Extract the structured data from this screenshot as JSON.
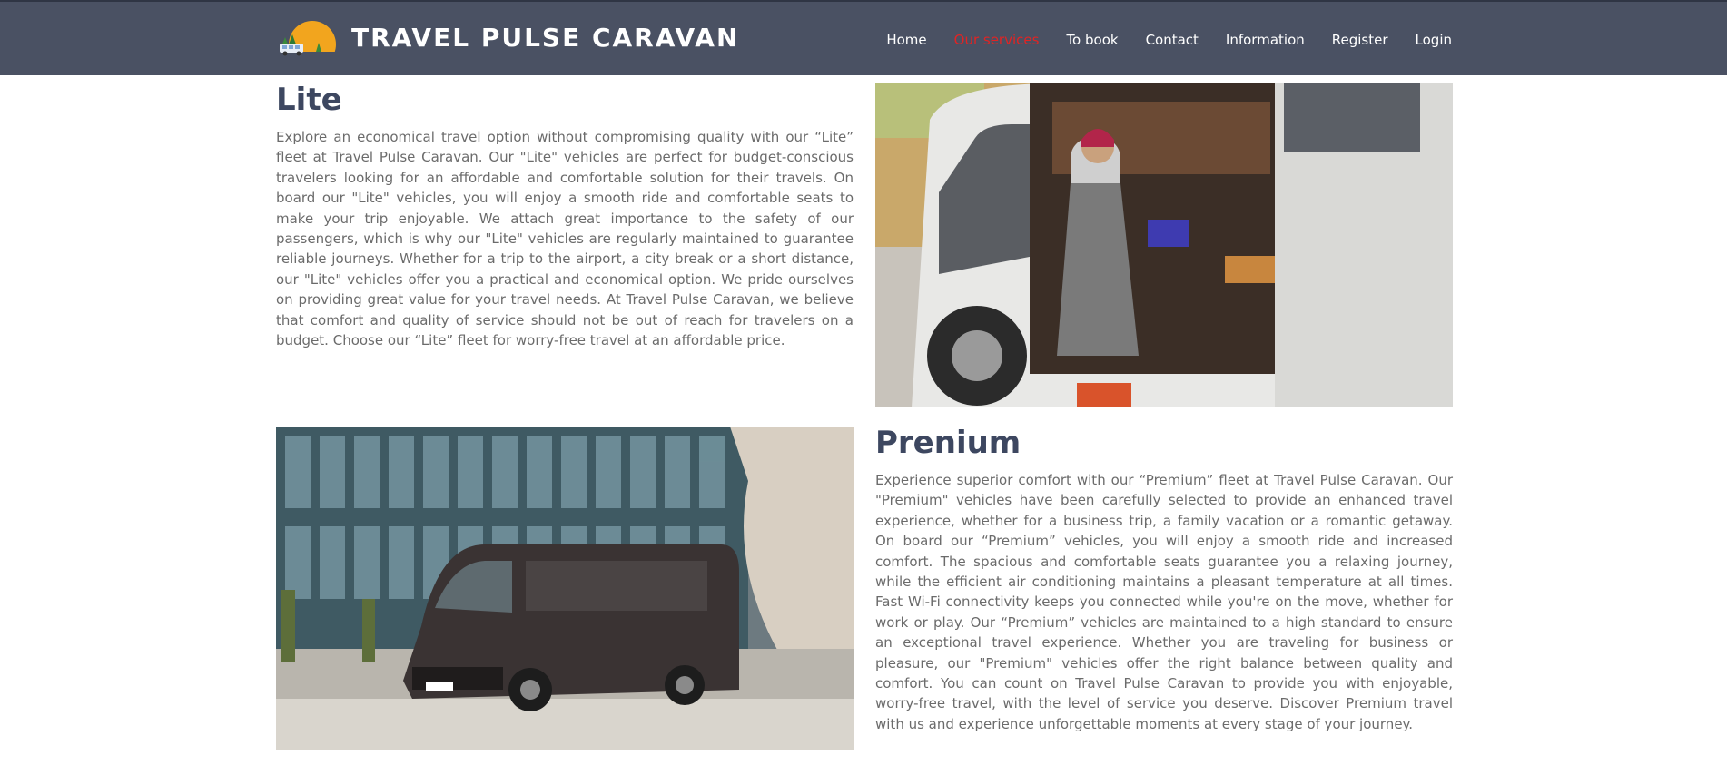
{
  "header": {
    "brand": "TRAVEL PULSE CARAVAN",
    "nav": [
      {
        "label": "Home"
      },
      {
        "label": "Our services"
      },
      {
        "label": "To book"
      },
      {
        "label": "Contact"
      },
      {
        "label": "Information"
      },
      {
        "label": "Register"
      },
      {
        "label": "Login"
      }
    ]
  },
  "colors": {
    "navbar_bg": "#4a5163",
    "active_link": "#e02424",
    "heading": "#3d4760",
    "body_text": "#6b6b6b"
  },
  "sections": {
    "lite": {
      "title": "Lite",
      "text": "Explore an economical travel option without compromising quality with our “Lite” fleet at Travel Pulse Caravan. Our \"Lite\" vehicles are perfect for budget-conscious travelers looking for an affordable and comfortable solution for their travels. On board our \"Lite\" vehicles, you will enjoy a smooth ride and comfortable seats to make your trip enjoyable. We attach great importance to the safety of our passengers, which is why our \"Lite\" vehicles are regularly maintained to guarantee reliable journeys. Whether for a trip to the airport, a city break or a short distance, our \"Lite\" vehicles offer you a practical and economical option. We pride ourselves on providing great value for your travel needs. At Travel Pulse Caravan, we believe that comfort and quality of service should not be out of reach for travelers on a budget. Choose our “Lite” fleet for worry-free travel at an affordable price."
    },
    "premium": {
      "title": "Prenium",
      "text": "Experience superior comfort with our “Premium” fleet at Travel Pulse Caravan. Our \"Premium\" vehicles have been carefully selected to provide an enhanced travel experience, whether for a business trip, a family vacation or a romantic getaway. On board our “Premium” vehicles, you will enjoy a smooth ride and increased comfort. The spacious and comfortable seats guarantee you a relaxing journey, while the efficient air conditioning maintains a pleasant temperature at all times. Fast Wi-Fi connectivity keeps you connected while you're on the move, whether for work or play. Our “Premium” vehicles are maintained to a high standard to ensure an exceptional travel experience. Whether you are traveling for business or pleasure, our \"Premium\" vehicles offer the right balance between quality and comfort. You can count on Travel Pulse Caravan to provide you with enjoyable, worry-free travel, with the level of service you deserve. Discover Premium travel with us and experience unforgettable moments at every stage of your journey."
    }
  }
}
